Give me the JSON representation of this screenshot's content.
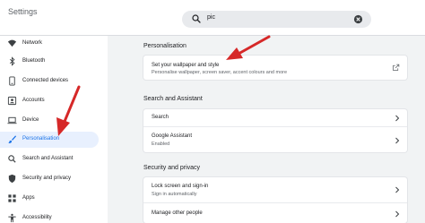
{
  "header": {
    "title": "Settings",
    "search": {
      "value": "pic",
      "icon": "search-icon",
      "clear_icon": "close-circle-icon"
    }
  },
  "sidebar": {
    "items": [
      {
        "label": "Network",
        "icon": "wifi-icon"
      },
      {
        "label": "Bluetooth",
        "icon": "bluetooth-icon"
      },
      {
        "label": "Connected devices",
        "icon": "connected-devices-icon"
      },
      {
        "label": "Accounts",
        "icon": "account-icon"
      },
      {
        "label": "Device",
        "icon": "laptop-icon"
      },
      {
        "label": "Personalisation",
        "icon": "brush-icon",
        "active": true
      },
      {
        "label": "Search and Assistant",
        "icon": "search-icon"
      },
      {
        "label": "Security and privacy",
        "icon": "shield-icon"
      },
      {
        "label": "Apps",
        "icon": "apps-grid-icon"
      },
      {
        "label": "Accessibility",
        "icon": "accessibility-icon"
      }
    ]
  },
  "main": {
    "personalisation": {
      "title": "Personalisation",
      "wallpaper": {
        "title": "Set your wallpaper and style",
        "subtitle": "Personalise wallpaper, screen saver, accent colours and more"
      }
    },
    "search_assistant": {
      "title": "Search and Assistant",
      "search_label": "Search",
      "assistant": {
        "title": "Google Assistant",
        "subtitle": "Enabled"
      }
    },
    "security": {
      "title": "Security and privacy",
      "lock_screen": {
        "title": "Lock screen and sign-in",
        "subtitle": "Sign in automatically"
      },
      "manage_people": "Manage other people"
    }
  },
  "colors": {
    "accent": "#1a73e8",
    "annotation_arrow": "#d62828",
    "active_nav_bg": "#e8f0fe"
  }
}
